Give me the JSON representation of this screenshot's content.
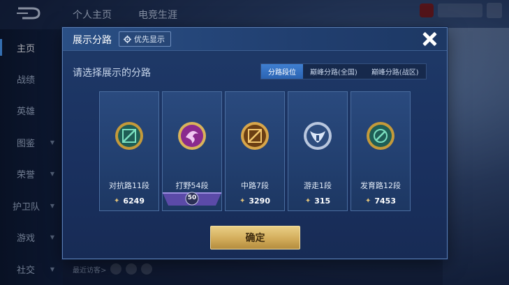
{
  "background": {
    "top_tabs": [
      "个人主页",
      "电竞生涯"
    ],
    "sidebar": [
      {
        "label": "主页",
        "active": true,
        "has_arrow": false
      },
      {
        "label": "战绩",
        "active": false,
        "has_arrow": false
      },
      {
        "label": "英雄",
        "active": false,
        "has_arrow": false
      },
      {
        "label": "图鉴",
        "active": false,
        "has_arrow": true
      },
      {
        "label": "荣誉",
        "active": false,
        "has_arrow": true
      },
      {
        "label": "护卫队",
        "active": false,
        "has_arrow": true
      },
      {
        "label": "游戏",
        "active": false,
        "has_arrow": true
      },
      {
        "label": "社交",
        "active": false,
        "has_arrow": true
      }
    ],
    "recent_visitors": "最近访客>"
  },
  "modal": {
    "title": "展示分路",
    "priority_button": "优先显示",
    "prompt": "请选择展示的分路",
    "tabs": [
      {
        "label": "分路段位",
        "active": true
      },
      {
        "label": "巅峰分路(全国)",
        "active": false
      },
      {
        "label": "巅峰分路(战区)",
        "active": false
      }
    ],
    "cards": [
      {
        "name": "对抗路11段",
        "score": "6249",
        "emblem": "clash-lane-emblem-icon",
        "color": "#3ab58a"
      },
      {
        "name": "打野54段",
        "score": null,
        "ribbon": "50",
        "emblem": "jungle-emblem-icon",
        "color": "#b23fb8"
      },
      {
        "name": "中路7段",
        "score": "3290",
        "emblem": "mid-lane-emblem-icon",
        "color": "#c98a2a"
      },
      {
        "name": "游走1段",
        "score": "315",
        "emblem": "roam-emblem-icon",
        "color": "#6f92c9"
      },
      {
        "name": "发育路12段",
        "score": "7453",
        "emblem": "farm-lane-emblem-icon",
        "color": "#3ab58a"
      }
    ],
    "confirm": "确定"
  },
  "colors": {
    "accent": "#3f7fd1",
    "gold": "#d3ad5b"
  }
}
